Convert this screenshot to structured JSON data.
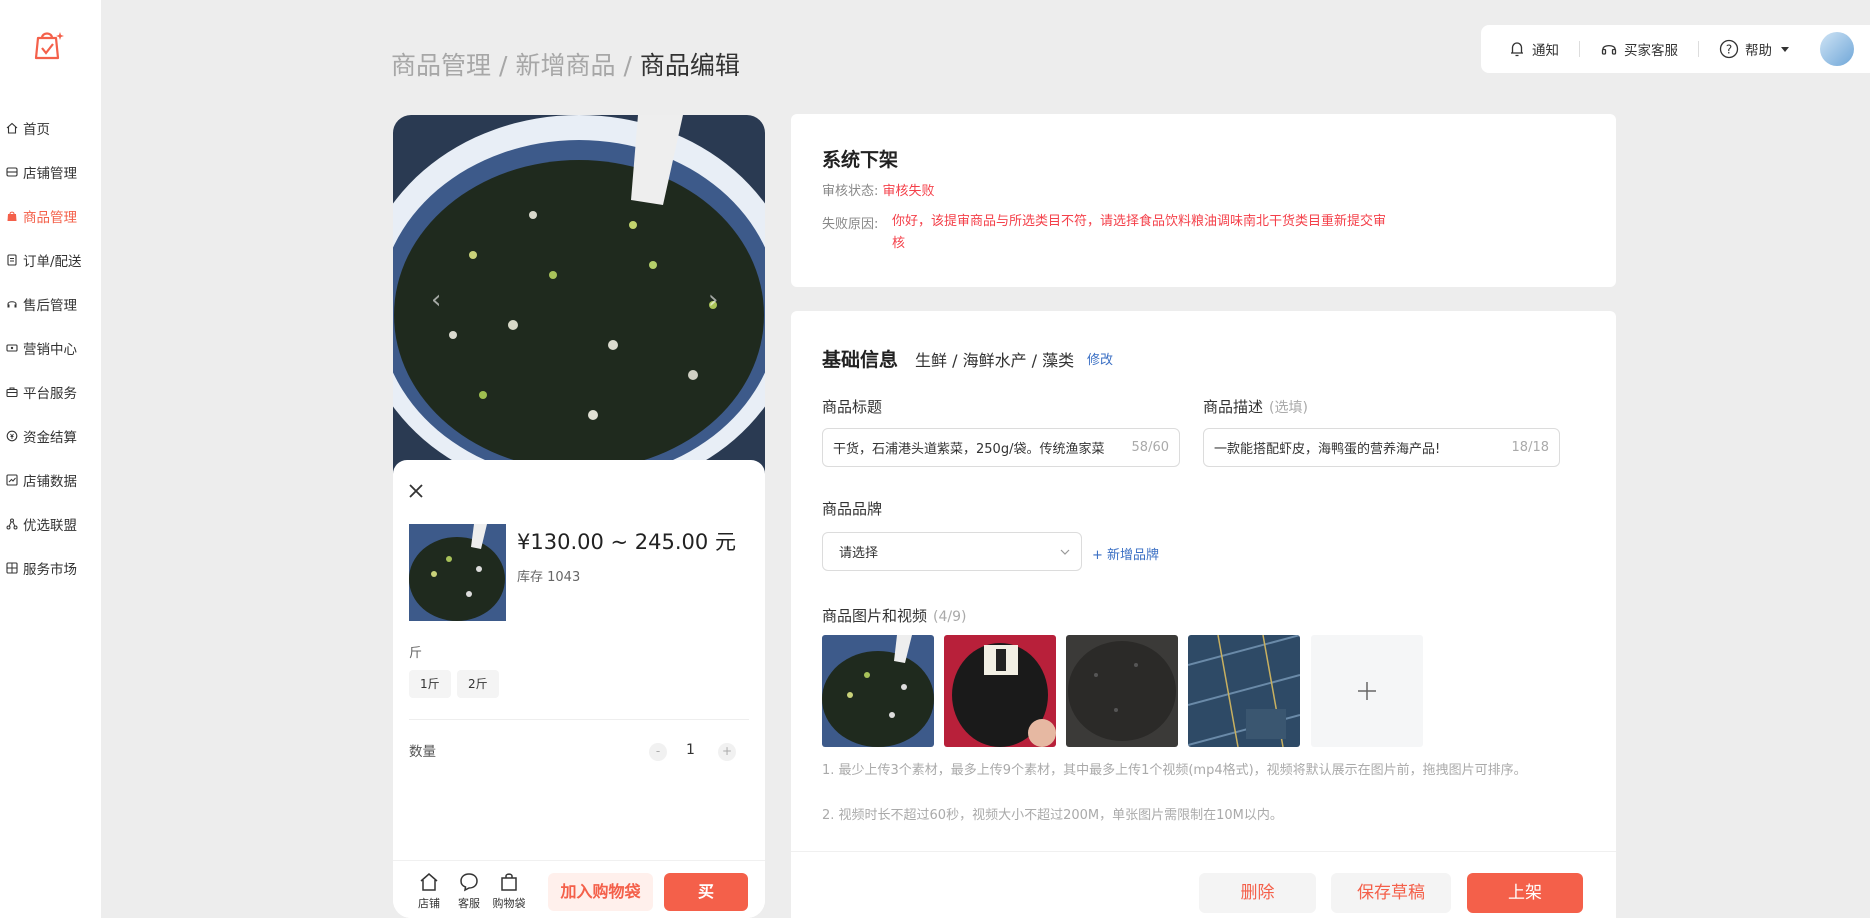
{
  "sidebar": {
    "items": [
      {
        "label": "首页",
        "icon": "home-icon"
      },
      {
        "label": "店铺管理",
        "icon": "store-icon"
      },
      {
        "label": "商品管理",
        "icon": "bag-icon",
        "active": true
      },
      {
        "label": "订单/配送",
        "icon": "order-icon"
      },
      {
        "label": "售后管理",
        "icon": "headset-icon"
      },
      {
        "label": "营销中心",
        "icon": "ticket-icon"
      },
      {
        "label": "平台服务",
        "icon": "briefcase-icon"
      },
      {
        "label": "资金结算",
        "icon": "coin-icon"
      },
      {
        "label": "店铺数据",
        "icon": "chart-icon"
      },
      {
        "label": "优选联盟",
        "icon": "network-icon"
      },
      {
        "label": "服务市场",
        "icon": "grid-icon"
      }
    ]
  },
  "breadcrumb": {
    "level1": "商品管理",
    "level2": "新增商品",
    "current": "商品编辑",
    "sep": "/"
  },
  "topbar": {
    "notify": "通知",
    "service": "买家客服",
    "help": "帮助"
  },
  "preview": {
    "price": "¥130.00 ~ 245.00 元",
    "stock": "库存 1043",
    "unit_label": "斤",
    "specs": [
      "1斤",
      "2斤"
    ],
    "qty_label": "数量",
    "qty_minus": "-",
    "qty_value": "1",
    "qty_plus": "+",
    "bar": {
      "store": "店铺",
      "service": "客服",
      "cart": "购物袋",
      "add_cart": "加入购物袋",
      "buy": "买"
    }
  },
  "status": {
    "title": "系统下架",
    "review_key": "审核状态:",
    "review_value": "审核失败",
    "reason_key": "失败原因:",
    "reason_value": "你好，该提审商品与所选类目不符，请选择食品饮料粮油调味南北干货类目重新提交审核"
  },
  "basic": {
    "title": "基础信息",
    "category": "生鲜 / 海鲜水产 / 藻类",
    "edit": "修改",
    "title_label": "商品标题",
    "title_value": "干货，石浦港头道紫菜，250g/袋。传统渔家菜",
    "title_count": "58/60",
    "desc_label": "商品描述",
    "desc_optional": "(选填)",
    "desc_value": "一款能搭配虾皮，海鸭蛋的营养海产品!",
    "desc_count": "18/18",
    "brand_label": "商品品牌",
    "brand_placeholder": "请选择",
    "add_brand": "+ 新增品牌",
    "media_label": "商品图片和视频",
    "media_count": "(4/9)",
    "hint1": "1. 最少上传3个素材，最多上传9个素材，其中最多上传1个视频(mp4格式)，视频将默认展示在图片前，拖拽图片可排序。",
    "hint2": "2. 视频时长不超过60秒，视频大小不超过200M，单张图片需限制在10M以内。"
  },
  "footer": {
    "delete": "删除",
    "save_draft": "保存草稿",
    "publish": "上架"
  },
  "colors": {
    "accent": "#f4604a",
    "error": "#f4404a",
    "link": "#3a6fc4"
  }
}
